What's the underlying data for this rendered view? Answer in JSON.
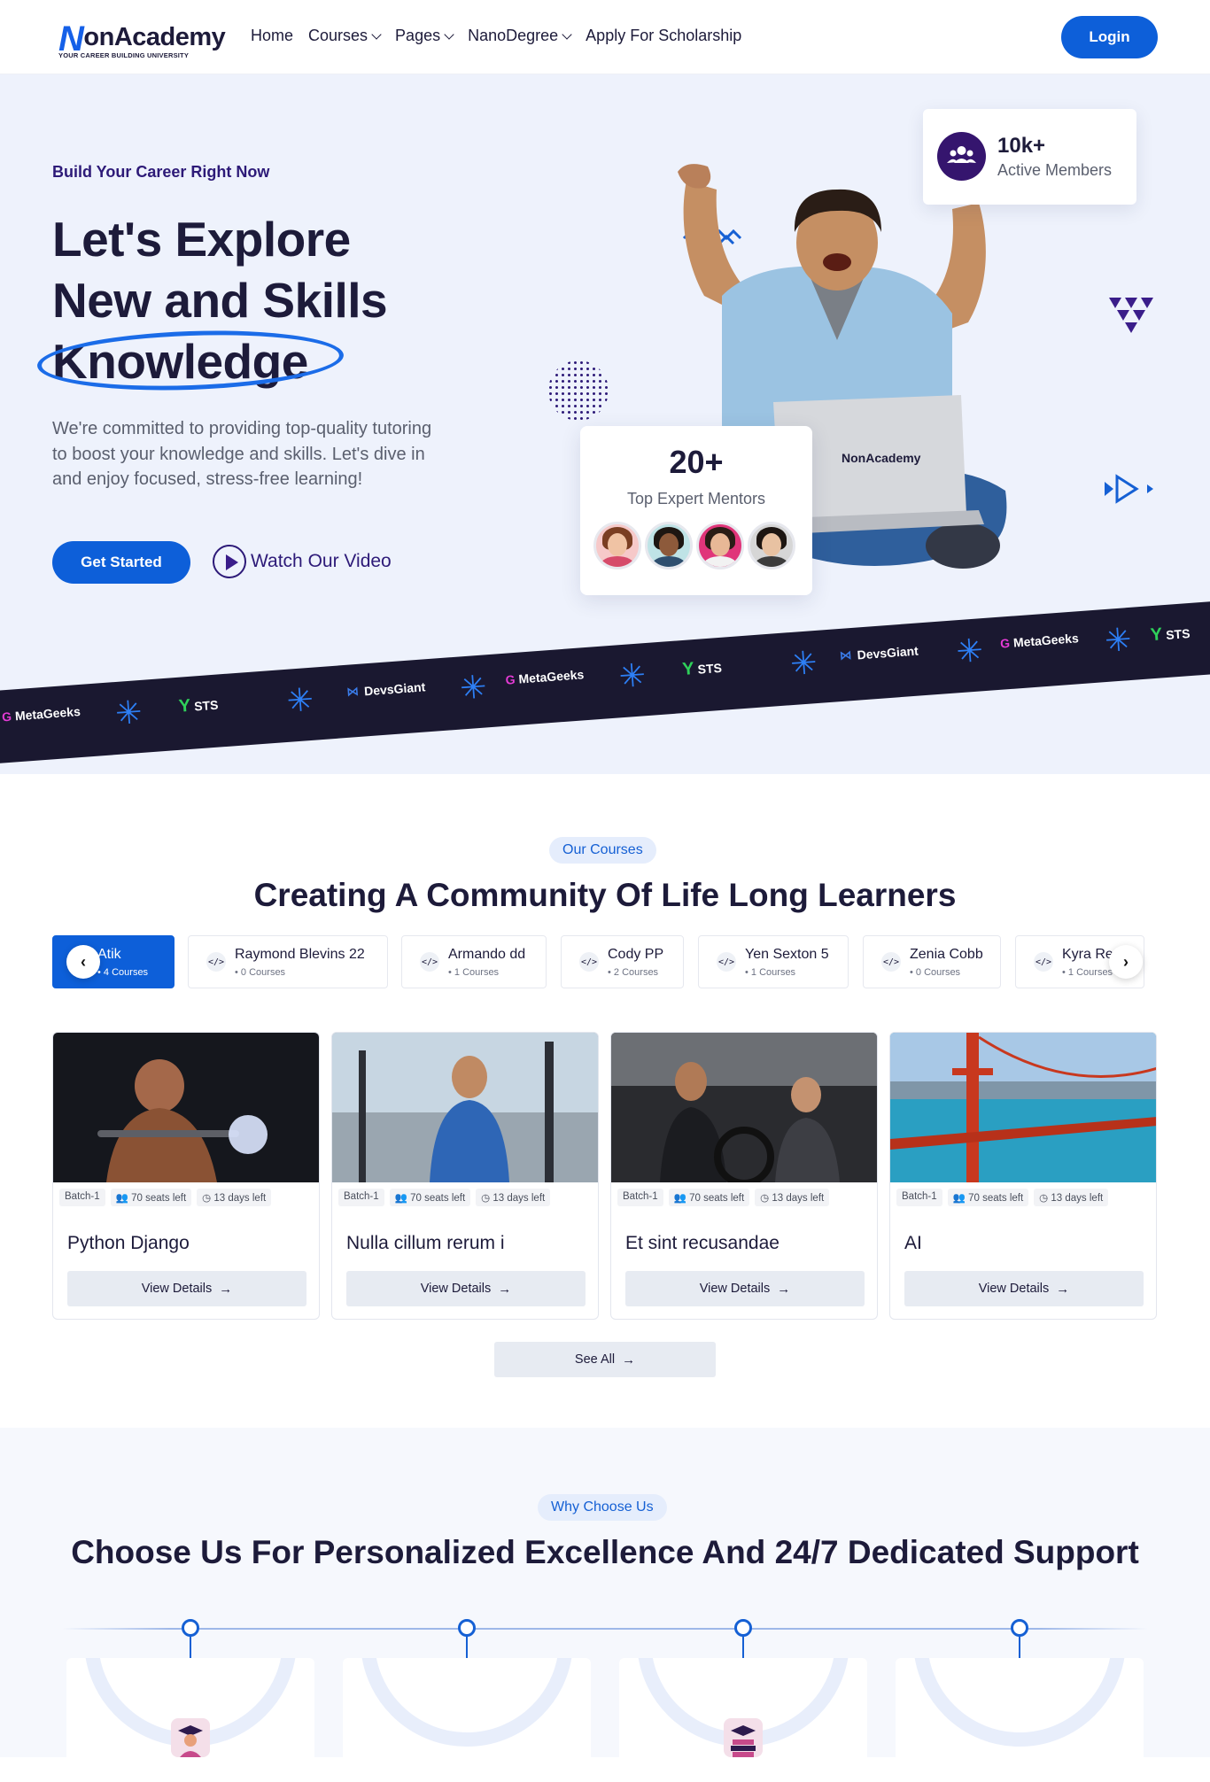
{
  "header": {
    "logo_main": "onAcademy",
    "logo_tagline": "YOUR CAREER BUILDING UNIVERSITY",
    "nav": [
      "Home",
      "Courses",
      "Pages",
      "NanoDegree",
      "Apply For Scholarship"
    ],
    "login_label": "Login"
  },
  "hero": {
    "kicker": "Build Your Career Right Now",
    "title_line1": "Let's Explore",
    "title_line2": "New and Skills",
    "title_line3": "Knowledge",
    "description": "We're committed to providing top-quality tutoring to boost your knowledge and skills. Let's dive in and enjoy focused, stress-free learning!",
    "primary_button": "Get Started",
    "video_button": "Watch Our Video",
    "members_count": "10k+",
    "members_label": "Active Members",
    "mentors_count": "20+",
    "mentors_label": "Top Expert Mentors"
  },
  "partners": [
    "MetaGeeks",
    "STS",
    "DevsGiant",
    "MetaGeeks",
    "STS",
    "DevsGiant",
    "MetaGeeks",
    "STS"
  ],
  "courses": {
    "pill": "Our Courses",
    "title": "Creating A Community Of Life Long Learners",
    "tabs": [
      {
        "name": "Atik",
        "count": "4 Courses"
      },
      {
        "name": "Raymond Blevins 22",
        "count": "0 Courses"
      },
      {
        "name": "Armando dd",
        "count": "1 Courses"
      },
      {
        "name": "Cody PP",
        "count": "2 Courses"
      },
      {
        "name": "Yen Sexton 5",
        "count": "1 Courses"
      },
      {
        "name": "Zenia Cobb",
        "count": "0 Courses"
      },
      {
        "name": "Kyra Re",
        "count": "1 Courses"
      }
    ],
    "cards": [
      {
        "title": "Python Django",
        "batch": "Batch-1",
        "seats": "70 seats left",
        "days": "13 days left",
        "button": "View Details"
      },
      {
        "title": "Nulla cillum rerum i",
        "batch": "Batch-1",
        "seats": "70 seats left",
        "days": "13 days left",
        "button": "View Details"
      },
      {
        "title": "Et sint recusandae",
        "batch": "Batch-1",
        "seats": "70 seats left",
        "days": "13 days left",
        "button": "View Details"
      },
      {
        "title": "AI",
        "batch": "Batch-1",
        "seats": "70 seats left",
        "days": "13 days left",
        "button": "View Details"
      }
    ],
    "see_all": "See All"
  },
  "why": {
    "pill": "Why Choose Us",
    "title": "Choose Us For Personalized Excellence And 24/7 Dedicated Support"
  },
  "colors": {
    "primary": "#0d5fd9",
    "dark": "#1d1b3a",
    "hero_bg": "#eef2fc",
    "banner_bg": "#1a1830"
  }
}
